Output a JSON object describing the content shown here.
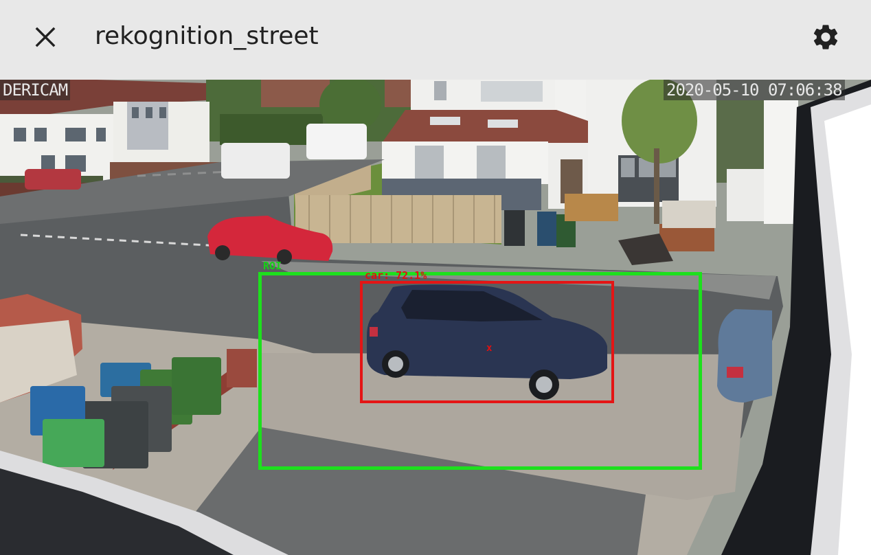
{
  "header": {
    "title": "rekognition_street",
    "close_icon": "close-icon",
    "settings_icon": "gear-icon"
  },
  "camera": {
    "brand_overlay": "DERICAM",
    "timestamp_overlay": "2020-05-10 07:06:38",
    "roi": {
      "label": "ROI",
      "color": "#1de01d"
    },
    "detection": {
      "label": "car: 72.1%",
      "centroid_marker": "x",
      "color": "#e41515"
    }
  },
  "colors": {
    "header_bg": "#e8e8e8",
    "header_text": "#212121",
    "roi_green": "#1de01d",
    "detection_red": "#e41515"
  }
}
